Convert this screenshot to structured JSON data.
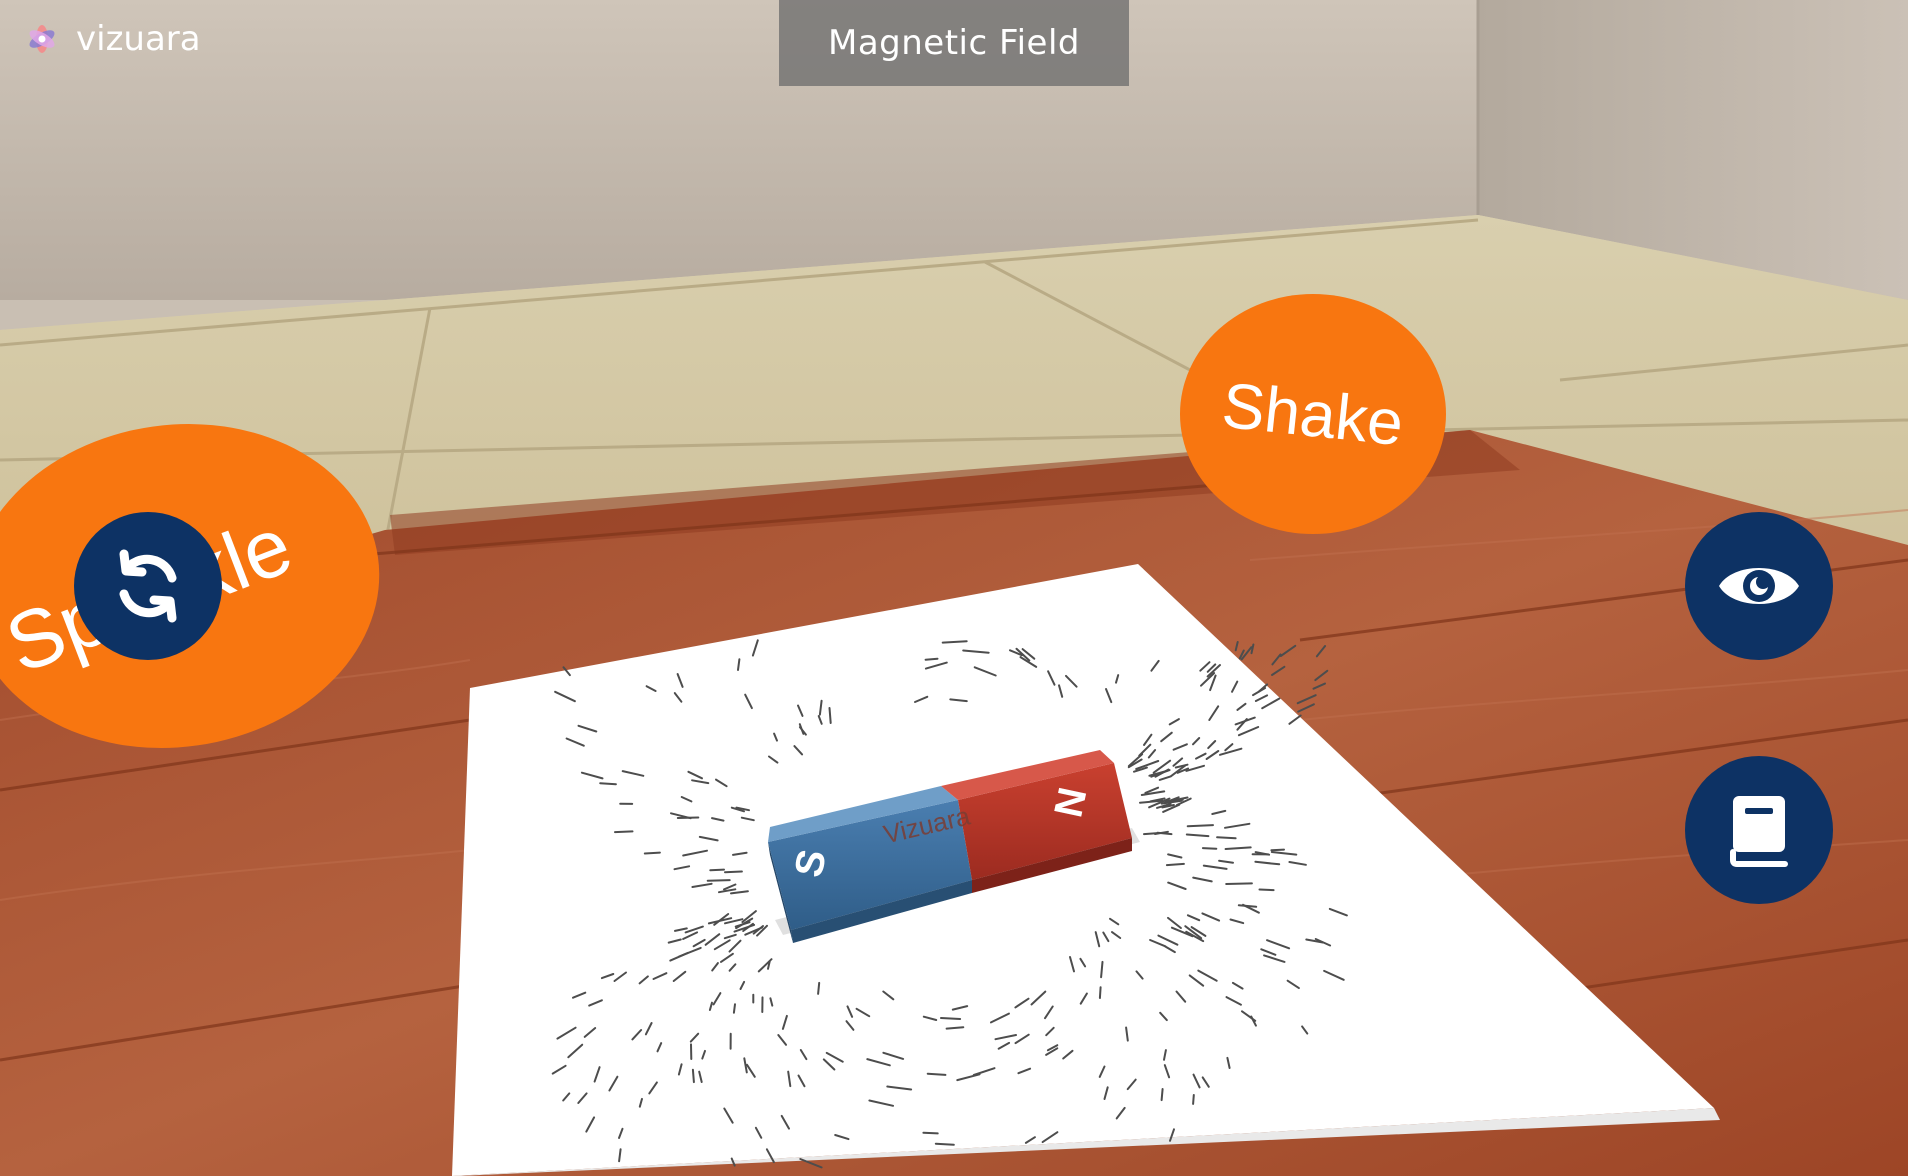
{
  "header": {
    "title": "Magnetic Field",
    "brand": "vizuara"
  },
  "scene": {
    "shake_label": "Shake",
    "sprinkle_label": "Sprinkle",
    "magnet": {
      "south": "S",
      "north": "N",
      "engraving": "Vizuara"
    }
  },
  "controls": {
    "reset_icon": "refresh-icon",
    "view_icon": "eye-icon",
    "book_icon": "book-icon"
  },
  "colors": {
    "button_bg": "#0d3264",
    "orange": "#f87610",
    "magnet_south": "#3a6e9c",
    "magnet_north": "#b93428"
  }
}
